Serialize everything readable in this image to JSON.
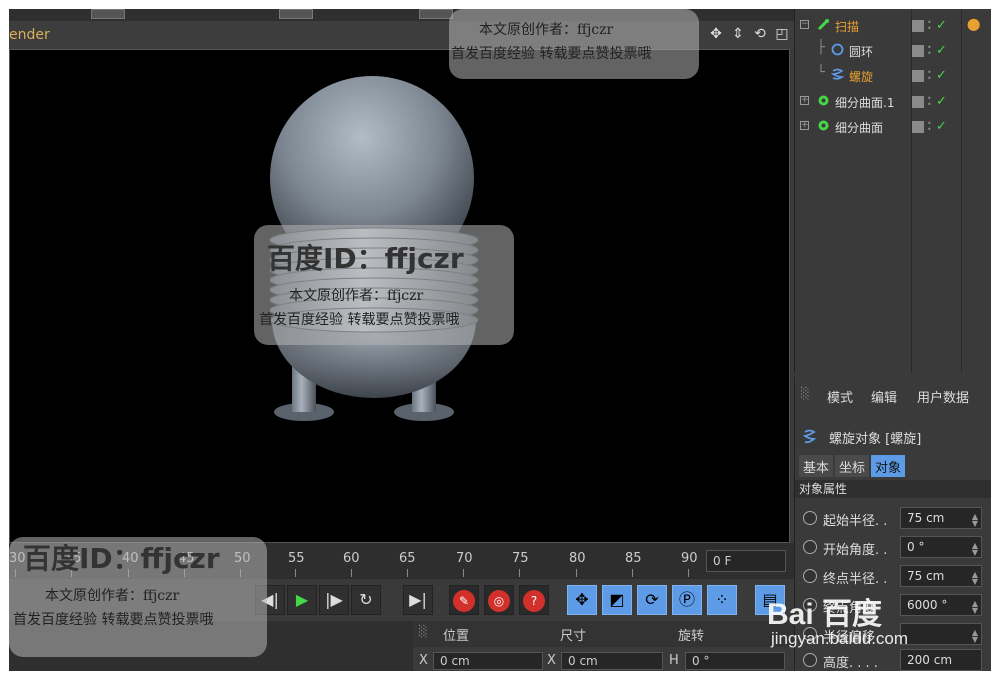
{
  "viewport": {
    "title": "ender",
    "nav_icons": [
      "move-icon",
      "zoom-icon",
      "rotate-icon",
      "layout-icon"
    ]
  },
  "object_manager": {
    "items": [
      {
        "name": "扫描",
        "highlighted": true
      },
      {
        "name": "圆环",
        "highlighted": false
      },
      {
        "name": "螺旋",
        "highlighted": true
      },
      {
        "name": "细分曲面.1",
        "highlighted": false
      },
      {
        "name": "细分曲面",
        "highlighted": false
      }
    ]
  },
  "attribute_manager": {
    "menu": [
      "模式",
      "编辑",
      "用户数据"
    ],
    "object_title": "螺旋对象 [螺旋]",
    "tabs": [
      "基本",
      "坐标",
      "对象"
    ],
    "active_tab": "对象",
    "section": "对象属性",
    "params": [
      {
        "label": "起始半径. .",
        "value": "75 cm"
      },
      {
        "label": "开始角度. .",
        "value": "0 °"
      },
      {
        "label": "终点半径. .",
        "value": "75 cm"
      },
      {
        "label": "终点角度",
        "value": "6000 °"
      },
      {
        "label": "半径偏移",
        "value": ""
      },
      {
        "label": "高度. . . .",
        "value": "200 cm"
      }
    ]
  },
  "timeline": {
    "ticks": [
      "30",
      "35",
      "40",
      "45",
      "50",
      "55",
      "60",
      "65",
      "70",
      "75",
      "80",
      "85",
      "90"
    ],
    "frame": "0 F"
  },
  "coords": {
    "headers": [
      "位置",
      "尺寸",
      "旋转"
    ],
    "row": {
      "x_label": "X",
      "x_value": "0 cm",
      "size_label": "X",
      "size_value": "0 cm",
      "rot_label": "H",
      "rot_value": "0 °"
    }
  },
  "watermarks": {
    "author": "本文原创作者：ffjczr",
    "notice": "首发百度经验  转载要点赞投票哦",
    "id_line": "百度ID：ffjczr",
    "baidu_logo": "Bai 百度",
    "site": "jingyan.baidu.com"
  },
  "colors": {
    "accent_orange": "#e8a030",
    "active_blue": "#5d9be6",
    "check_green": "#46d646",
    "key_red": "#d2302a"
  }
}
